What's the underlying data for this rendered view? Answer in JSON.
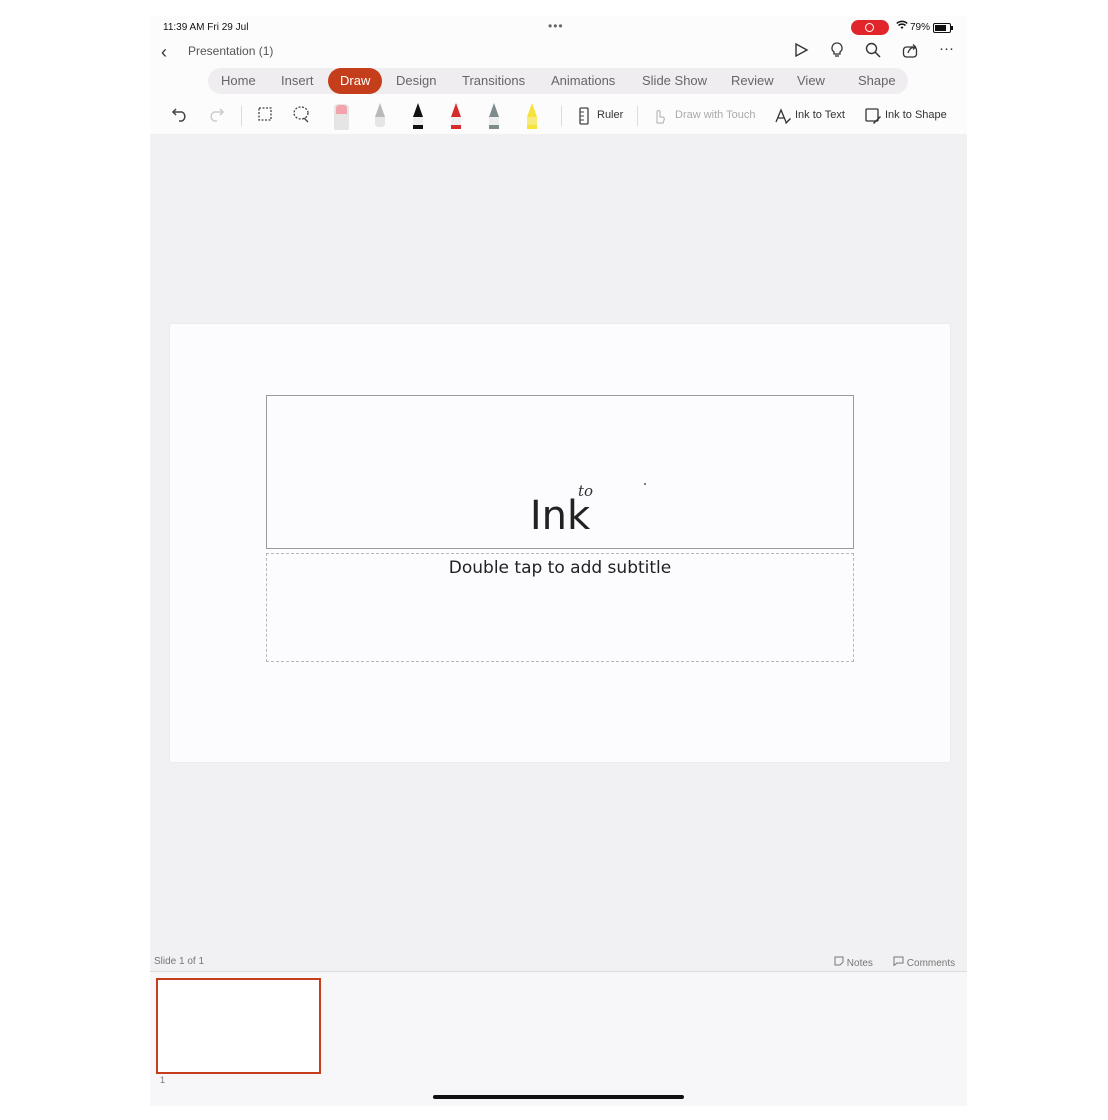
{
  "status": {
    "time": "11:39 AM  Fri 29 Jul",
    "dots": "•••",
    "battery": "79%"
  },
  "titlebar": {
    "title": "Presentation (1)"
  },
  "tabs": [
    {
      "label": "Home"
    },
    {
      "label": "Insert"
    },
    {
      "label": "Draw",
      "active": true
    },
    {
      "label": "Design"
    },
    {
      "label": "Transitions"
    },
    {
      "label": "Animations"
    },
    {
      "label": "Slide Show"
    },
    {
      "label": "Review"
    },
    {
      "label": "View"
    },
    {
      "label": "Shape"
    }
  ],
  "toolbar": {
    "ruler": "Ruler",
    "draw_with_touch": "Draw with Touch",
    "ink_to_text": "Ink to Text",
    "ink_to_shape": "Ink to Shape",
    "pen_colors": [
      "#9a9a9a",
      "#111111",
      "#d42b2b",
      "#7f8c8d",
      "#f5e33a"
    ]
  },
  "slide": {
    "title": "Ink",
    "ink_annotation": "to",
    "subtitle": "Double tap to add subtitle"
  },
  "footer": {
    "slide_count": "Slide 1 of 1",
    "notes": "Notes",
    "comments": "Comments"
  },
  "thumbnails": [
    {
      "number": "1"
    }
  ],
  "colors": {
    "accent": "#c43e1c",
    "recording": "#e0262b"
  }
}
